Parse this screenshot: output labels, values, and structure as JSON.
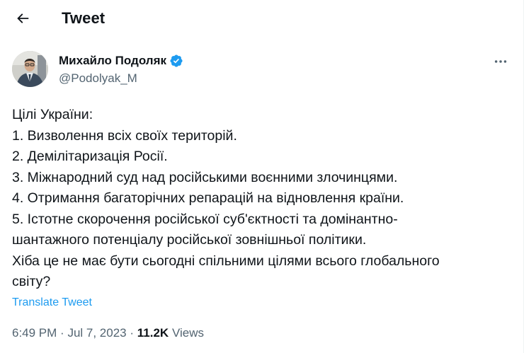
{
  "header": {
    "title": "Tweet",
    "back_icon": "arrow-left-icon"
  },
  "author": {
    "name": "Михайло Подоляк",
    "handle": "@Podolyak_M",
    "verified_icon": "verified-badge-icon",
    "verified_color": "#1d9bf0"
  },
  "tweet": {
    "lines": [
      "Цілі України:",
      "1. Визволення всіх своїх територій.",
      "2. Демілітаризація Росії.",
      "3. Міжнародний суд над російськими воєнними злочинцями.",
      "4. Отримання багаторічних репарацій на відновлення країни.",
      "5. Істотне скорочення російської суб'єктності та домінантно-",
      "шантажного потенціалу російської зовнішньої політики.",
      "Хіба це не має бути сьогодні спільними цілями всього глобального",
      "світу?"
    ],
    "translate_label": "Translate Tweet"
  },
  "meta": {
    "time": "6:49 PM",
    "separator": "·",
    "date": "Jul 7, 2023",
    "views_count": "11.2K",
    "views_label": "Views"
  },
  "colors": {
    "text_primary": "#0f1419",
    "text_secondary": "#536471",
    "accent": "#1d9bf0"
  }
}
